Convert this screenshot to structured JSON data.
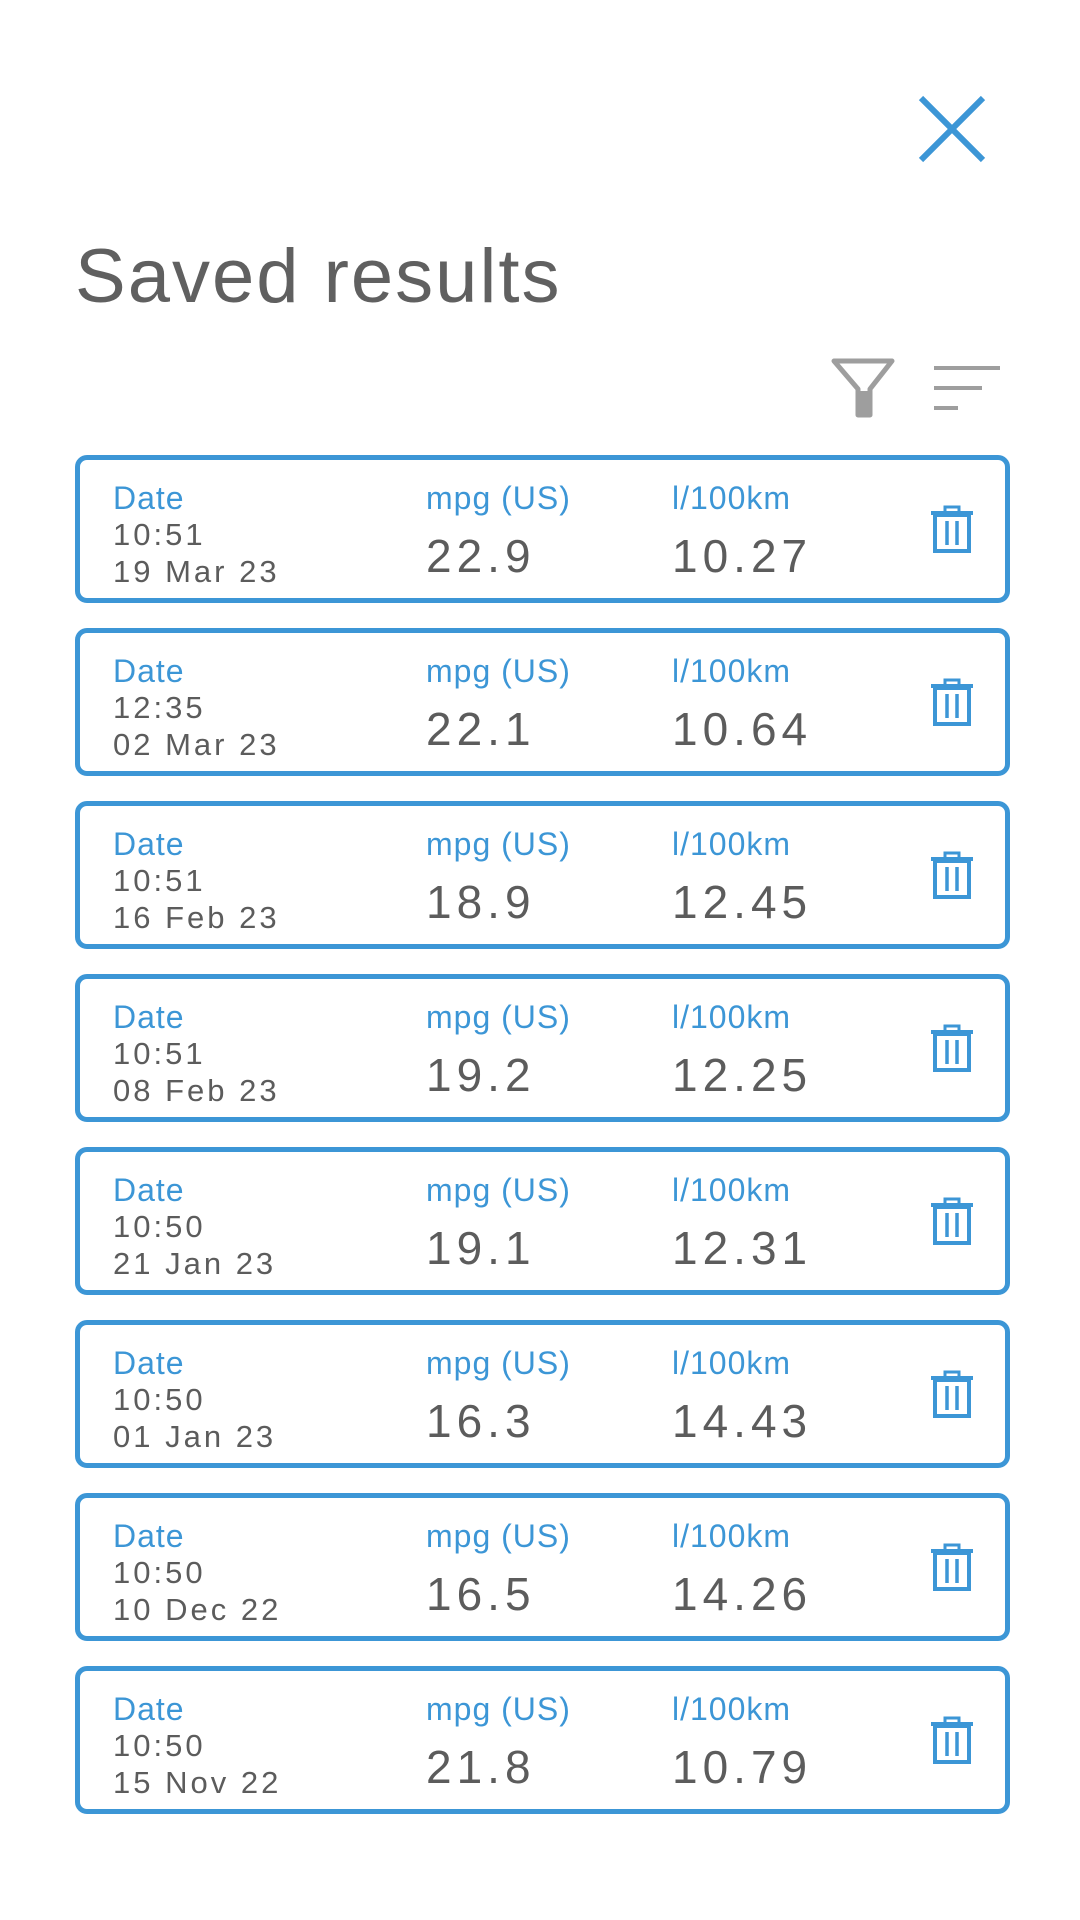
{
  "header": {
    "title": "Saved results",
    "close_icon": "close-icon",
    "filter_icon": "filter-icon",
    "sort_icon": "sort-icon"
  },
  "colors": {
    "accent": "#3c96d6",
    "title_text": "#606060",
    "value_text": "#5c5c5c",
    "toolbar_icon": "#9e9e9e"
  },
  "labels": {
    "date": "Date",
    "mpg": "mpg (US)",
    "l100km": "l/100km"
  },
  "results": [
    {
      "time": "10:51",
      "date": "19 Mar 23",
      "mpg": "22.9",
      "l100km": "10.27"
    },
    {
      "time": "12:35",
      "date": "02 Mar 23",
      "mpg": "22.1",
      "l100km": "10.64"
    },
    {
      "time": "10:51",
      "date": "16 Feb 23",
      "mpg": "18.9",
      "l100km": "12.45"
    },
    {
      "time": "10:51",
      "date": "08 Feb 23",
      "mpg": "19.2",
      "l100km": "12.25"
    },
    {
      "time": "10:50",
      "date": "21 Jan 23",
      "mpg": "19.1",
      "l100km": "12.31"
    },
    {
      "time": "10:50",
      "date": "01 Jan 23",
      "mpg": "16.3",
      "l100km": "14.43"
    },
    {
      "time": "10:50",
      "date": "10 Dec 22",
      "mpg": "16.5",
      "l100km": "14.26"
    },
    {
      "time": "10:50",
      "date": "15 Nov 22",
      "mpg": "21.8",
      "l100km": "10.79"
    }
  ]
}
